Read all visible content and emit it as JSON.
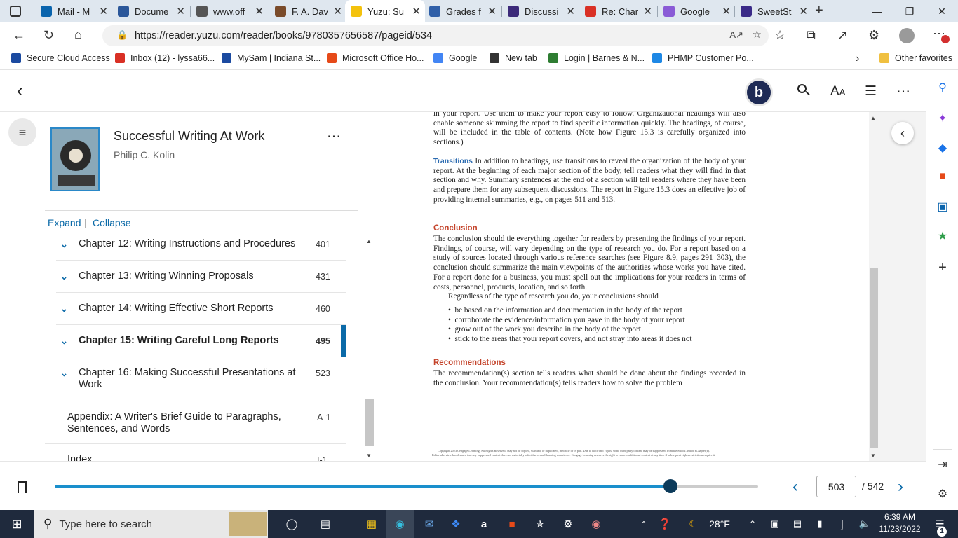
{
  "browser": {
    "tabs": [
      {
        "label": "Mail - M",
        "icon": "outlook-icon",
        "color": "#0a64ad"
      },
      {
        "label": "Docume",
        "icon": "word-icon",
        "color": "#2b579a"
      },
      {
        "label": "www.off",
        "icon": "page-icon",
        "color": "#555555"
      },
      {
        "label": "F. A. Dav",
        "icon": "globe-icon",
        "color": "#7a4b2a"
      },
      {
        "label": "Yuzu: Su",
        "icon": "yuzu-icon",
        "color": "#f4c20d",
        "active": true
      },
      {
        "label": "Grades f",
        "icon": "puzzle-icon",
        "color": "#2f5fa8"
      },
      {
        "label": "Discussi",
        "icon": "discussion-icon",
        "color": "#3c2a7a"
      },
      {
        "label": "Re: Char",
        "icon": "gmail-icon",
        "color": "#d93025"
      },
      {
        "label": "Google",
        "icon": "feather-icon",
        "color": "#8a5bd6"
      },
      {
        "label": "SweetSt",
        "icon": "sweet-icon",
        "color": "#3a2a88"
      }
    ],
    "url": "https://reader.yuzu.com/reader/books/9780357656587/pageid/534",
    "favorites": [
      {
        "label": "Secure Cloud Access",
        "color": "#1b4aa0"
      },
      {
        "label": "Inbox (12) - lyssa66...",
        "color": "#d93025"
      },
      {
        "label": "MySam | Indiana St...",
        "color": "#1b4aa0"
      },
      {
        "label": "Microsoft Office Ho...",
        "color": "#e64a19"
      },
      {
        "label": "Google",
        "color": "#4285f4"
      },
      {
        "label": "New tab",
        "color": "#333333"
      },
      {
        "label": "Login | Barnes & N...",
        "color": "#2e7d32"
      },
      {
        "label": "PHMP Customer Po...",
        "color": "#1e88e5"
      }
    ],
    "other_favorites": "Other favorites"
  },
  "reader": {
    "avatar_letter": "b",
    "book": {
      "title": "Successful Writing At Work",
      "author": "Philip C. Kolin"
    },
    "toc_controls": {
      "expand": "Expand",
      "separator": "|",
      "collapse": "Collapse"
    },
    "toc": [
      {
        "label": "Chapter 12: Writing Instructions and Procedures",
        "page": "401",
        "expandable": true
      },
      {
        "label": "Chapter 13: Writing Winning Proposals",
        "page": "431",
        "expandable": true
      },
      {
        "label": "Chapter 14: Writing Effective Short Reports",
        "page": "460",
        "expandable": true
      },
      {
        "label": "Chapter 15: Writing Careful Long Reports",
        "page": "495",
        "expandable": true,
        "current": true
      },
      {
        "label": "Chapter 16: Making Successful Presentations at Work",
        "page": "523",
        "expandable": true
      },
      {
        "label": "Appendix: A Writer's Brief Guide to Paragraphs, Sentences, and Words",
        "page": "A-1",
        "expandable": false
      },
      {
        "label": "Index",
        "page": "I-1",
        "expandable": false
      }
    ],
    "page_text": {
      "intro_lines": "in your report. Use them to make your report easy to follow. Organizational headings will also enable someone skimming the report to find specific information quickly. The headings, of course, will be included in the table of contents. (Note how Figure 15.3 is carefully organized into sections.)",
      "transitions_head": "Transitions",
      "transitions_body": "In addition to headings, use transitions to reveal the organization of the body of your report. At the beginning of each major section of the body, tell readers what they will find in that section and why. Summary sentences at the end of a section will tell readers where they have been and prepare them for any subsequent discussions. The report in Figure 15.3 does an effective job of providing internal summaries, e.g., on pages 511 and 513.",
      "conclusion_head": "Conclusion",
      "conclusion_body": "The conclusion should tie everything together for readers by presenting the findings of your report. Findings, of course, will vary depending on the type of research you do. For a report based on a study of sources located through various reference searches (see Figure 8.9, pages 291–303), the conclusion should summarize the main viewpoints of the authorities whose works you have cited. For a report done for a business, you must spell out the implications for your readers in terms of costs, personnel, products, location, and so forth.",
      "regardless": "Regardless of the type of research you do, your conclusions should",
      "bullets": [
        "be based on the information and documentation in the body of the report",
        "corroborate the evidence/information you gave in the body of your report",
        "grow out of the work you describe in the body of the report",
        "stick to the areas that your report covers, and not stray into areas it does not"
      ],
      "recommendations_head": "Recommendations",
      "recommendations_body": "The recommendation(s) section tells readers what should be done about the findings recorded in the conclusion. Your recommendation(s) tells readers how to solve the problem",
      "copyright_1": "Copyright 2023 Cengage Learning. All Rights Reserved. May not be copied, scanned, or duplicated, in whole or in part. Due to electronic rights, some third party content may be suppressed from the eBook and/or eChapter(s).",
      "copyright_2": "Editorial review has deemed that any suppressed content does not materially affect the overall learning experience. Cengage Learning reserves the right to remove additional content at any time if subsequent rights restrictions require it."
    },
    "pager": {
      "current_page": "503",
      "total": "/ 542",
      "progress": 0.875
    }
  },
  "taskbar": {
    "search_placeholder": "Type here to search",
    "temperature": "28°F",
    "time": "6:39 AM",
    "date": "11/23/2022",
    "notification_count": "1"
  },
  "colors": {
    "accent": "#0b6aa8",
    "heading_red": "#c4432a",
    "taskbar_bg": "#1f2a3d"
  }
}
